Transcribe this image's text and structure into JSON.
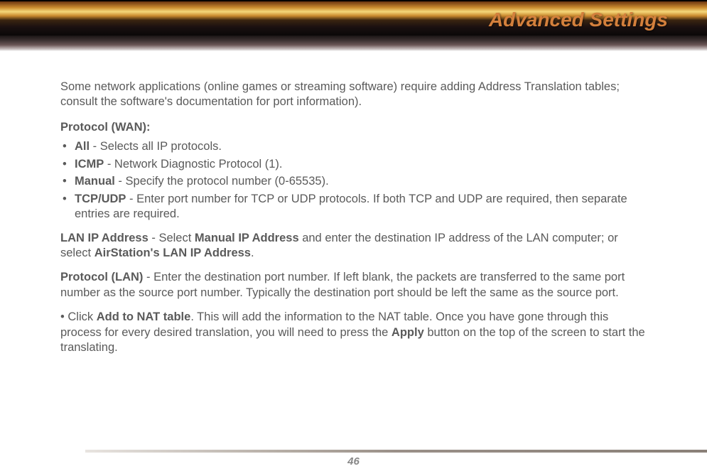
{
  "header": {
    "title": "Advanced Settings"
  },
  "content": {
    "intro": "Some network applications (online games or streaming software) require adding Address Translation tables; consult the software's documentation for port information).",
    "protocol_wan_label": "Protocol (WAN):",
    "bullets": {
      "all_bold": "All",
      "all_rest": " - Selects all IP protocols.",
      "icmp_bold": "ICMP",
      "icmp_rest": " - Network Diagnostic Protocol (1).",
      "manual_bold": "Manual",
      "manual_rest": " - Specify the protocol number (0-65535).",
      "tcp_bold": "TCP/UDP",
      "tcp_rest": " - Enter port number for TCP or UDP protocols.  If both TCP and UDP are required, then separate entries are required."
    },
    "lan_ip_b1": "LAN IP Address",
    "lan_ip_t1": " - Select ",
    "lan_ip_b2": "Manual IP Address",
    "lan_ip_t2": " and enter the destination IP address of the LAN computer; or select ",
    "lan_ip_b3": "AirStation's LAN IP Address",
    "lan_ip_t3": ".",
    "protocol_lan_b": "Protocol (LAN)",
    "protocol_lan_t": " - Enter the destination port number.  If left blank, the packets are transferred to the same port number as the source port number.  Typically the destination port should be left the same as the source port.",
    "nat_t1": "• Click ",
    "nat_b1": "Add to NAT table",
    "nat_t2": ".  This will add the information to the NAT table.  Once you have gone through this process for every desired translation, you will need to press the ",
    "nat_b2": "Apply",
    "nat_t3": " button on the top of the screen to start the translating."
  },
  "footer": {
    "page_number": "46"
  }
}
